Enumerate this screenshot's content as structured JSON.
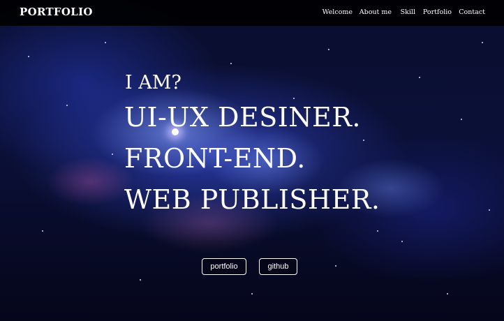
{
  "brand": {
    "logo_text": "PORTFOLIO"
  },
  "nav": {
    "items": [
      {
        "label": "Welcome"
      },
      {
        "label": "About me"
      },
      {
        "label": "Skill"
      },
      {
        "label": "Portfolio"
      },
      {
        "label": "Contact"
      }
    ]
  },
  "hero": {
    "intro": "I AM?",
    "lines": [
      "UI-UX DESINER.",
      "FRONT-END.",
      "WEB PUBLISHER."
    ]
  },
  "buttons": {
    "portfolio_label": "portfolio",
    "github_label": "github"
  },
  "colors": {
    "navbar_bg": "#000000",
    "text": "#ffffff",
    "background": "#0b1038"
  }
}
